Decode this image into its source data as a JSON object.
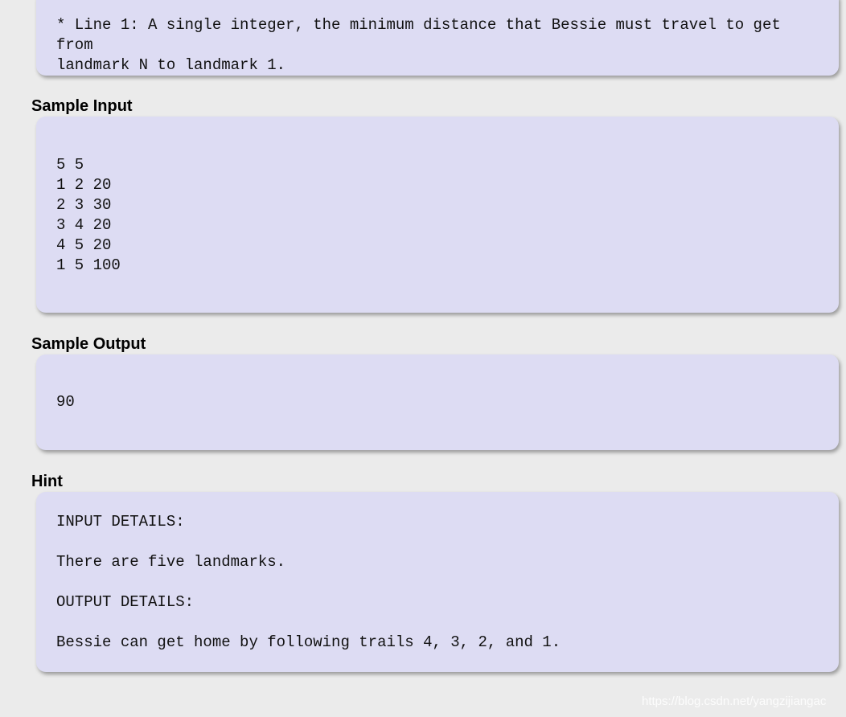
{
  "output_section": {
    "text": "* Line 1: A single integer, the minimum distance that Bessie must travel to get from\nlandmark N to landmark 1."
  },
  "sample_input": {
    "heading": "Sample Input",
    "text": "5 5\n1 2 20\n2 3 30\n3 4 20\n4 5 20\n1 5 100"
  },
  "sample_output": {
    "heading": "Sample Output",
    "text": "90"
  },
  "hint": {
    "heading": "Hint",
    "text": "INPUT DETAILS:\n\nThere are five landmarks.\n\nOUTPUT DETAILS:\n\nBessie can get home by following trails 4, 3, 2, and 1."
  },
  "watermark": "https://blog.csdn.net/yangzijiangac"
}
